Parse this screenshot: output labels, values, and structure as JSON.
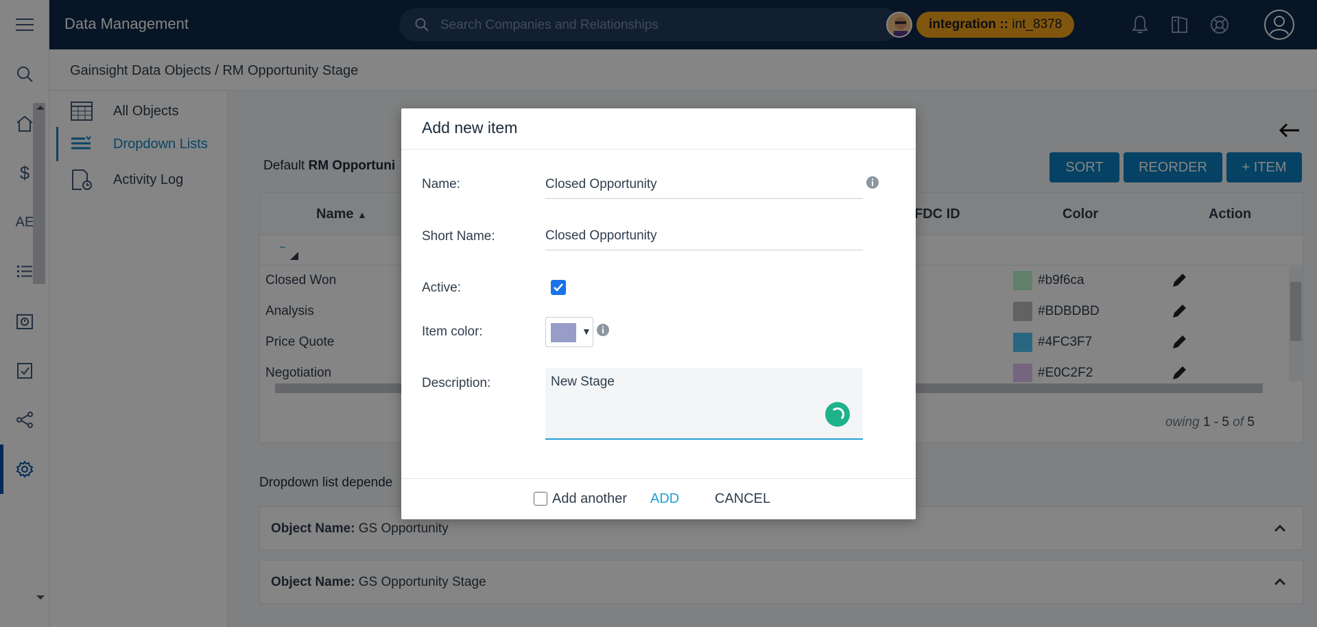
{
  "header": {
    "app_title": "Data Management",
    "search_placeholder": "Search Companies and Relationships",
    "tenant_prefix": "integration",
    "tenant_sep": " :: ",
    "tenant_id": "int_8378"
  },
  "breadcrumb": "Gainsight Data Objects / RM Opportunity Stage",
  "rail": {
    "ab_label": "AE"
  },
  "sidenav": [
    {
      "label": "All Objects",
      "icon": "table-icon"
    },
    {
      "label": "Dropdown Lists",
      "icon": "list-icon",
      "active": true
    },
    {
      "label": "Activity Log",
      "icon": "log-icon"
    }
  ],
  "main": {
    "default_prefix": "Default ",
    "default_bold": "RM Opportuni",
    "buttons": {
      "sort": "SORT",
      "reorder": "REORDER",
      "item": "+ ITEM"
    },
    "columns": {
      "name": "Name",
      "sfdc": "FDC ID",
      "color": "Color",
      "action": "Action"
    },
    "rows": [
      {
        "name": "Closed Won",
        "color": "#b9f6ca",
        "swatch": "#b9f6ca"
      },
      {
        "name": "Analysis",
        "color": "#BDBDBD",
        "swatch": "#BDBDBD"
      },
      {
        "name": "Price Quote",
        "color": "#4FC3F7",
        "swatch": "#4FC3F7"
      },
      {
        "name": "Negotiation",
        "color": "#E0C2F2",
        "swatch": "#E0C2F2"
      }
    ],
    "pager": {
      "prefix": "owing ",
      "range": "1 - 5",
      "of": " of ",
      "total": "5"
    },
    "dependency_label": "Dropdown list depende",
    "accordions": [
      {
        "key": "Object Name:",
        "value": " GS Opportunity"
      },
      {
        "key": "Object Name:",
        "value": " GS Opportunity Stage"
      }
    ]
  },
  "modal": {
    "title": "Add new item",
    "name_label": "Name:",
    "name_value": "Closed Opportunity",
    "short_name_label": "Short Name:",
    "short_name_value": "Closed Opportunity",
    "active_label": "Active:",
    "active_checked": true,
    "item_color_label": "Item color:",
    "item_color_value": "#979dc8",
    "description_label": "Description:",
    "description_value": "New Stage",
    "add_another_label": "Add another",
    "add_label": "ADD",
    "cancel_label": "CANCEL"
  }
}
